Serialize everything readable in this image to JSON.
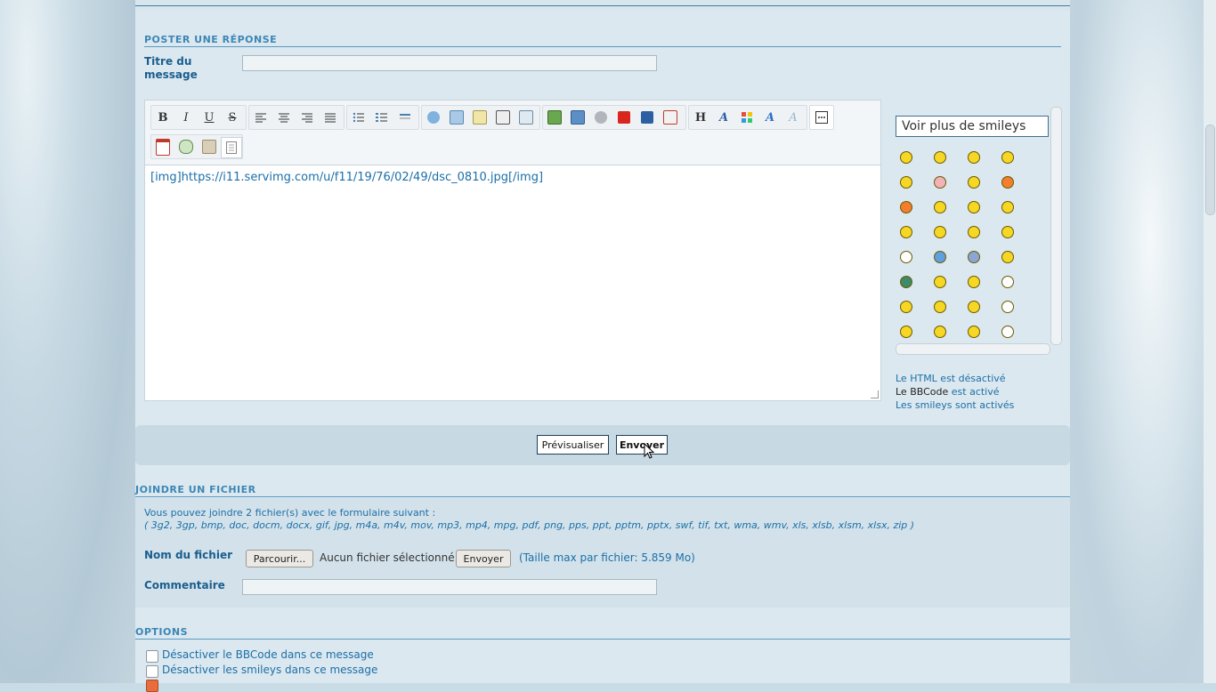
{
  "reply_section": {
    "title": "POSTER UNE RÉPONSE",
    "subject_label_line1": "Titre du",
    "subject_label_line2": "message",
    "subject_value": ""
  },
  "editor": {
    "content": "[img]https://i11.servimg.com/u/f11/19/76/02/49/dsc_0810.jpg[/img]",
    "toolbar_bold": "B",
    "toolbar_italic": "I",
    "toolbar_underline": "U",
    "toolbar_strike": "S",
    "toolbar_heading": "H"
  },
  "smileys": {
    "select_label": "Voir plus de smileys",
    "count": 32
  },
  "status": {
    "html_off": "Le HTML est désactivé",
    "bbcode_prefix": "Le BBCode",
    "bbcode_suffix": "est activé",
    "smileys_on": "Les smileys sont activés"
  },
  "buttons": {
    "preview": "Prévisualiser",
    "send": "Envoyer"
  },
  "attach": {
    "title": "JOINDRE UN FICHIER",
    "intro": "Vous pouvez joindre 2 fichier(s) avec le formulaire suivant :",
    "extensions": "( 3g2, 3gp, bmp, doc, docm, docx, gif, jpg, m4a, m4v, mov, mp3, mp4, mpg, pdf, png, pps, ppt, pptm, pptx, swf, tif, txt, wma, wmv, xls, xlsb, xlsm, xlsx, zip )",
    "file_label": "Nom du fichier",
    "browse": "Parcourir...",
    "no_file": "Aucun fichier sélectionné.",
    "upload": "Envoyer",
    "max_size": "(Taille max par fichier: 5.859 Mo)",
    "comment_label": "Commentaire",
    "comment_value": ""
  },
  "options": {
    "title": "OPTIONS",
    "items": [
      {
        "label": "Désactiver le BBCode dans ce message",
        "checked": false
      },
      {
        "label": "Désactiver les smileys dans ce message",
        "checked": false
      }
    ]
  }
}
